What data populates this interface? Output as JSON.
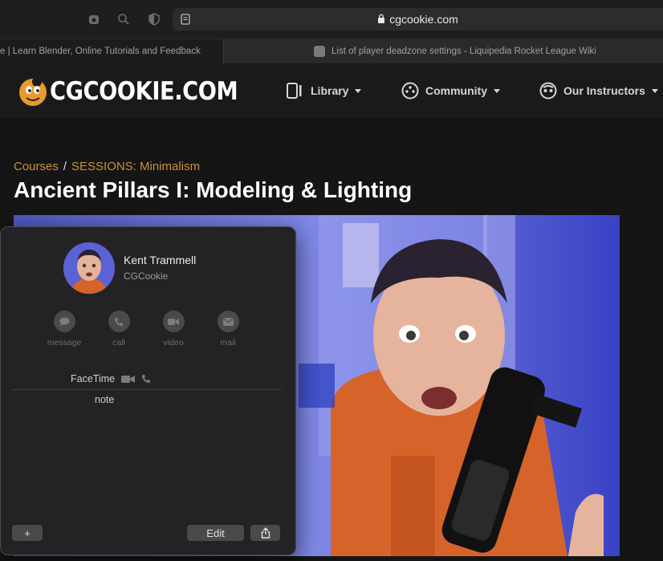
{
  "browser": {
    "url": "cgcookie.com",
    "tabs": [
      {
        "title": "e | Learn Blender, Online Tutorials and Feedback"
      },
      {
        "title": "List of player deadzone settings - Liquipedia Rocket League Wiki"
      }
    ]
  },
  "site": {
    "logo_text": "CGCOOKIE.COM",
    "nav": [
      {
        "label": "Library",
        "icon": "library-icon"
      },
      {
        "label": "Community",
        "icon": "community-icon"
      },
      {
        "label": "Our Instructors",
        "icon": "instructors-icon"
      }
    ],
    "accent_color": "#c9913a"
  },
  "page": {
    "breadcrumb": [
      "Courses",
      "SESSIONS: Minimalism"
    ],
    "breadcrumb_separator": "/",
    "title": "Ancient Pillars I: Modeling & Lighting"
  },
  "contact_card": {
    "name": "Kent Trammell",
    "organization": "CGCookie",
    "actions": [
      {
        "label": "message",
        "icon": "message-icon"
      },
      {
        "label": "call",
        "icon": "phone-icon"
      },
      {
        "label": "video",
        "icon": "video-icon"
      },
      {
        "label": "mail",
        "icon": "mail-icon"
      }
    ],
    "facetime_label": "FaceTime",
    "note_label": "note",
    "add_label": "+",
    "edit_label": "Edit"
  }
}
